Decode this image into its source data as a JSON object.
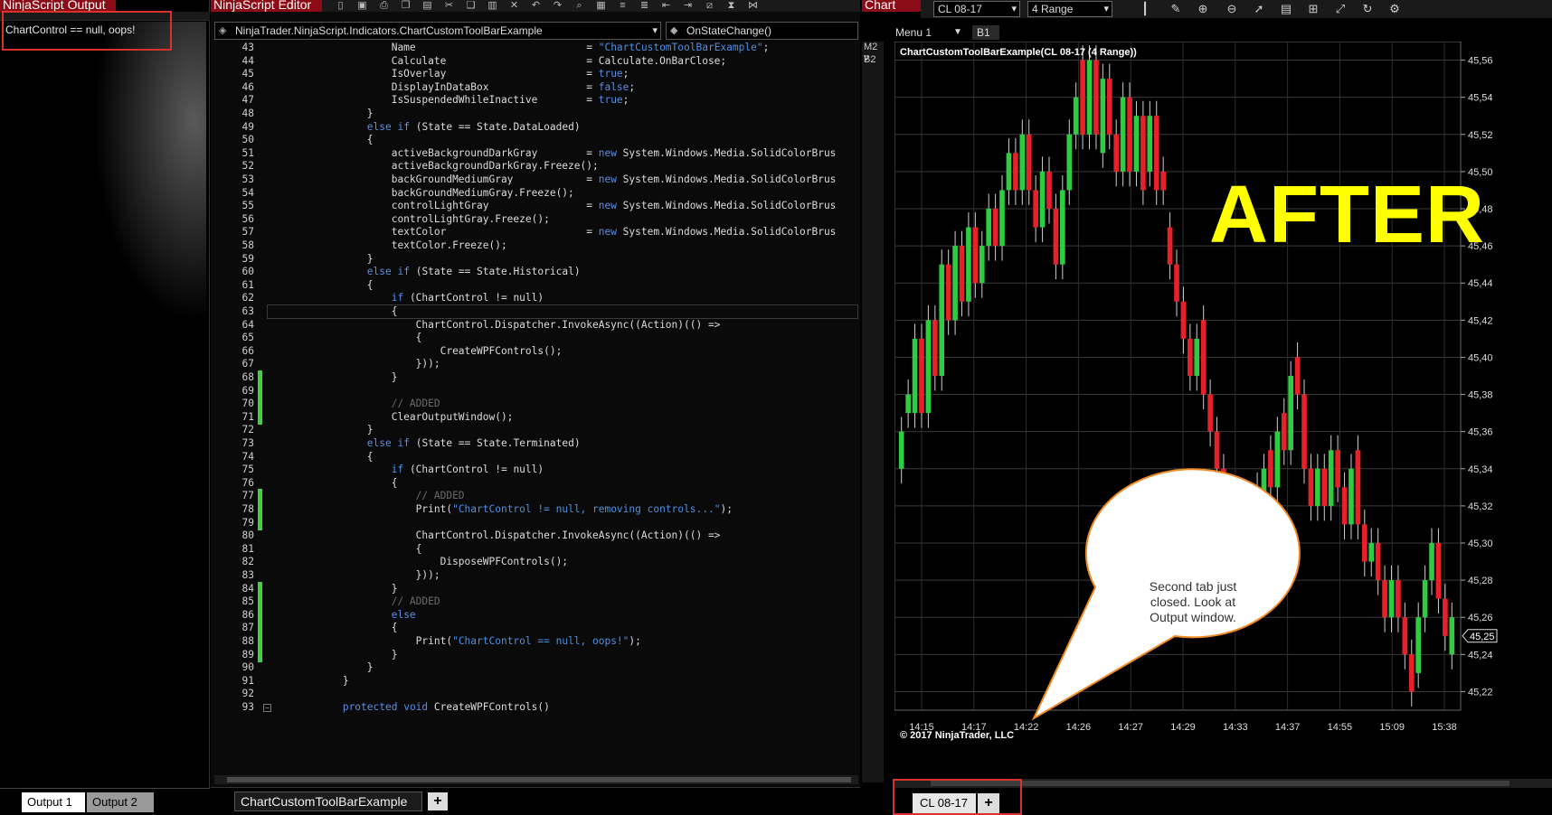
{
  "output": {
    "title": "NinjaScript Output",
    "line": "ChartControl == null, oops!",
    "tabs": [
      "Output 1",
      "Output 2"
    ]
  },
  "editor": {
    "title": "NinjaScript Editor",
    "class_combo": "NinjaTrader.NinjaScript.Indicators.ChartCustomToolBarExample",
    "method_combo": "OnStateChange()",
    "tab": "ChartCustomToolBarExample",
    "add_tab": "+",
    "lines": [
      {
        "n": "43",
        "code": "                    Name                            = \"ChartCustomToolBarExample\";",
        "chg": false
      },
      {
        "n": "44",
        "code": "                    Calculate                       = Calculate.OnBarClose;",
        "chg": false
      },
      {
        "n": "45",
        "code": "                    IsOverlay                       = true;",
        "chg": false
      },
      {
        "n": "46",
        "code": "                    DisplayInDataBox                = false;",
        "chg": false
      },
      {
        "n": "47",
        "code": "                    IsSuspendedWhileInactive        = true;",
        "chg": false
      },
      {
        "n": "48",
        "code": "                }",
        "chg": false
      },
      {
        "n": "49",
        "code": "                else if (State == State.DataLoaded)",
        "chg": false
      },
      {
        "n": "50",
        "code": "                {",
        "chg": false
      },
      {
        "n": "51",
        "code": "                    activeBackgroundDarkGray        = new System.Windows.Media.SolidColorBrus",
        "chg": false
      },
      {
        "n": "52",
        "code": "                    activeBackgroundDarkGray.Freeze();",
        "chg": false
      },
      {
        "n": "53",
        "code": "                    backGroundMediumGray            = new System.Windows.Media.SolidColorBrus",
        "chg": false
      },
      {
        "n": "54",
        "code": "                    backGroundMediumGray.Freeze();",
        "chg": false
      },
      {
        "n": "55",
        "code": "                    controlLightGray                = new System.Windows.Media.SolidColorBrus",
        "chg": false
      },
      {
        "n": "56",
        "code": "                    controlLightGray.Freeze();",
        "chg": false
      },
      {
        "n": "57",
        "code": "                    textColor                       = new System.Windows.Media.SolidColorBrus",
        "chg": false
      },
      {
        "n": "58",
        "code": "                    textColor.Freeze();",
        "chg": false
      },
      {
        "n": "59",
        "code": "                }",
        "chg": false
      },
      {
        "n": "60",
        "code": "                else if (State == State.Historical)",
        "chg": false
      },
      {
        "n": "61",
        "code": "                {",
        "chg": false
      },
      {
        "n": "62",
        "code": "                    if (ChartControl != null)",
        "chg": false
      },
      {
        "n": "63",
        "code": "                    {",
        "chg": false
      },
      {
        "n": "64",
        "code": "                        ChartControl.Dispatcher.InvokeAsync((Action)(() =>",
        "chg": false
      },
      {
        "n": "65",
        "code": "                        {",
        "chg": false
      },
      {
        "n": "66",
        "code": "                            CreateWPFControls();",
        "chg": false
      },
      {
        "n": "67",
        "code": "                        }));",
        "chg": false
      },
      {
        "n": "68",
        "code": "                    }",
        "chg": true
      },
      {
        "n": "69",
        "code": "",
        "chg": true
      },
      {
        "n": "70",
        "code": "                    // ADDED",
        "chg": true
      },
      {
        "n": "71",
        "code": "                    ClearOutputWindow();",
        "chg": true
      },
      {
        "n": "72",
        "code": "                }",
        "chg": false
      },
      {
        "n": "73",
        "code": "                else if (State == State.Terminated)",
        "chg": false
      },
      {
        "n": "74",
        "code": "                {",
        "chg": false
      },
      {
        "n": "75",
        "code": "                    if (ChartControl != null)",
        "chg": false
      },
      {
        "n": "76",
        "code": "                    {",
        "chg": false
      },
      {
        "n": "77",
        "code": "                        // ADDED",
        "chg": true
      },
      {
        "n": "78",
        "code": "                        Print(\"ChartControl != null, removing controls...\");",
        "chg": true
      },
      {
        "n": "79",
        "code": "",
        "chg": true
      },
      {
        "n": "80",
        "code": "                        ChartControl.Dispatcher.InvokeAsync((Action)(() =>",
        "chg": false
      },
      {
        "n": "81",
        "code": "                        {",
        "chg": false
      },
      {
        "n": "82",
        "code": "                            DisposeWPFControls();",
        "chg": false
      },
      {
        "n": "83",
        "code": "                        }));",
        "chg": false
      },
      {
        "n": "84",
        "code": "                    }",
        "chg": true
      },
      {
        "n": "85",
        "code": "                    // ADDED",
        "chg": true
      },
      {
        "n": "86",
        "code": "                    else",
        "chg": true
      },
      {
        "n": "87",
        "code": "                    {",
        "chg": true
      },
      {
        "n": "88",
        "code": "                        Print(\"ChartControl == null, oops!\");",
        "chg": true
      },
      {
        "n": "89",
        "code": "                    }",
        "chg": true
      },
      {
        "n": "90",
        "code": "                }",
        "chg": false
      },
      {
        "n": "91",
        "code": "            }",
        "chg": false
      },
      {
        "n": "92",
        "code": "",
        "chg": false
      },
      {
        "n": "93",
        "code": "            protected void CreateWPFControls()",
        "chg": false
      }
    ]
  },
  "chart": {
    "title": "Chart",
    "instrument": "CL 08-17",
    "period": "4 Range",
    "menu": "Menu 1",
    "bars_tab": "B1",
    "side_labels": [
      "M2 v",
      "B2"
    ],
    "label": "ChartCustomToolBarExample(CL 08-17 (4 Range))",
    "watermark": "© 2017 NinjaTrader, LLC",
    "overlay": "AFTER",
    "callout": "Second tab just closed. Look at Output window.",
    "tab": "CL 08-17",
    "add_tab": "+",
    "colors": {
      "up": "#2ecc40",
      "down": "#e8202a",
      "overlay": "#ffff00",
      "highlight": "#d9322b",
      "callout_border": "#f08a24"
    }
  },
  "chart_data": {
    "type": "candlestick",
    "y_ticks": [
      "45,56",
      "45,54",
      "45,52",
      "45,50",
      "45,48",
      "45,46",
      "45,44",
      "45,42",
      "45,40",
      "45,38",
      "45,36",
      "45,34",
      "45,32",
      "45,30",
      "45,28",
      "45,26",
      "45,24",
      "45,22"
    ],
    "ylim": [
      45.21,
      45.57
    ],
    "x_ticks": [
      "14:15",
      "14:17",
      "14:22",
      "14:26",
      "14:27",
      "14:29",
      "14:33",
      "14:37",
      "14:55",
      "15:09",
      "15:38"
    ],
    "last_price": "45,25",
    "bars": [
      {
        "o": 45.34,
        "c": 45.36,
        "d": "up"
      },
      {
        "o": 45.37,
        "c": 45.38,
        "d": "up"
      },
      {
        "o": 45.37,
        "c": 45.41,
        "d": "up"
      },
      {
        "o": 45.41,
        "c": 45.37,
        "d": "down"
      },
      {
        "o": 45.37,
        "c": 45.42,
        "d": "up"
      },
      {
        "o": 45.42,
        "c": 45.39,
        "d": "down"
      },
      {
        "o": 45.39,
        "c": 45.45,
        "d": "up"
      },
      {
        "o": 45.45,
        "c": 45.42,
        "d": "down"
      },
      {
        "o": 45.42,
        "c": 45.46,
        "d": "up"
      },
      {
        "o": 45.46,
        "c": 45.43,
        "d": "down"
      },
      {
        "o": 45.43,
        "c": 45.47,
        "d": "up"
      },
      {
        "o": 45.47,
        "c": 45.44,
        "d": "down"
      },
      {
        "o": 45.44,
        "c": 45.46,
        "d": "up"
      },
      {
        "o": 45.46,
        "c": 45.48,
        "d": "up"
      },
      {
        "o": 45.48,
        "c": 45.46,
        "d": "down"
      },
      {
        "o": 45.46,
        "c": 45.49,
        "d": "up"
      },
      {
        "o": 45.49,
        "c": 45.51,
        "d": "up"
      },
      {
        "o": 45.51,
        "c": 45.49,
        "d": "down"
      },
      {
        "o": 45.49,
        "c": 45.52,
        "d": "up"
      },
      {
        "o": 45.52,
        "c": 45.49,
        "d": "down"
      },
      {
        "o": 45.49,
        "c": 45.47,
        "d": "down"
      },
      {
        "o": 45.47,
        "c": 45.5,
        "d": "up"
      },
      {
        "o": 45.5,
        "c": 45.48,
        "d": "down"
      },
      {
        "o": 45.48,
        "c": 45.45,
        "d": "down"
      },
      {
        "o": 45.45,
        "c": 45.49,
        "d": "up"
      },
      {
        "o": 45.49,
        "c": 45.52,
        "d": "up"
      },
      {
        "o": 45.52,
        "c": 45.54,
        "d": "up"
      },
      {
        "o": 45.56,
        "c": 45.52,
        "d": "down"
      },
      {
        "o": 45.52,
        "c": 45.56,
        "d": "up"
      },
      {
        "o": 45.56,
        "c": 45.52,
        "d": "down"
      },
      {
        "o": 45.51,
        "c": 45.55,
        "d": "up"
      },
      {
        "o": 45.55,
        "c": 45.52,
        "d": "down"
      },
      {
        "o": 45.52,
        "c": 45.5,
        "d": "down"
      },
      {
        "o": 45.5,
        "c": 45.54,
        "d": "up"
      },
      {
        "o": 45.54,
        "c": 45.5,
        "d": "down"
      },
      {
        "o": 45.5,
        "c": 45.53,
        "d": "up"
      },
      {
        "o": 45.53,
        "c": 45.49,
        "d": "down"
      },
      {
        "o": 45.5,
        "c": 45.53,
        "d": "up"
      },
      {
        "o": 45.53,
        "c": 45.49,
        "d": "down"
      },
      {
        "o": 45.5,
        "c": 45.49,
        "d": "down"
      },
      {
        "o": 45.47,
        "c": 45.45,
        "d": "down"
      },
      {
        "o": 45.45,
        "c": 45.43,
        "d": "down"
      },
      {
        "o": 45.43,
        "c": 45.41,
        "d": "down"
      },
      {
        "o": 45.41,
        "c": 45.39,
        "d": "down"
      },
      {
        "o": 45.39,
        "c": 45.41,
        "d": "up"
      },
      {
        "o": 45.42,
        "c": 45.38,
        "d": "down"
      },
      {
        "o": 45.38,
        "c": 45.36,
        "d": "down"
      },
      {
        "o": 45.36,
        "c": 45.34,
        "d": "down"
      },
      {
        "o": 45.34,
        "c": 45.32,
        "d": "down"
      },
      {
        "o": 45.32,
        "c": 45.3,
        "d": "down"
      },
      {
        "o": 45.3,
        "c": 45.32,
        "d": "up"
      },
      {
        "o": 45.32,
        "c": 45.3,
        "d": "down"
      },
      {
        "o": 45.3,
        "c": 45.32,
        "d": "up"
      },
      {
        "o": 45.33,
        "c": 45.31,
        "d": "down"
      },
      {
        "o": 45.31,
        "c": 45.34,
        "d": "up"
      },
      {
        "o": 45.35,
        "c": 45.33,
        "d": "down"
      },
      {
        "o": 45.33,
        "c": 45.36,
        "d": "up"
      },
      {
        "o": 45.37,
        "c": 45.35,
        "d": "down"
      },
      {
        "o": 45.35,
        "c": 45.39,
        "d": "up"
      },
      {
        "o": 45.4,
        "c": 45.38,
        "d": "down"
      },
      {
        "o": 45.38,
        "c": 45.34,
        "d": "down"
      },
      {
        "o": 45.34,
        "c": 45.32,
        "d": "down"
      },
      {
        "o": 45.32,
        "c": 45.34,
        "d": "up"
      },
      {
        "o": 45.34,
        "c": 45.32,
        "d": "down"
      },
      {
        "o": 45.32,
        "c": 45.35,
        "d": "up"
      },
      {
        "o": 45.35,
        "c": 45.33,
        "d": "down"
      },
      {
        "o": 45.33,
        "c": 45.31,
        "d": "down"
      },
      {
        "o": 45.31,
        "c": 45.34,
        "d": "up"
      },
      {
        "o": 45.35,
        "c": 45.31,
        "d": "down"
      },
      {
        "o": 45.31,
        "c": 45.29,
        "d": "down"
      },
      {
        "o": 45.29,
        "c": 45.3,
        "d": "up"
      },
      {
        "o": 45.3,
        "c": 45.28,
        "d": "down"
      },
      {
        "o": 45.28,
        "c": 45.26,
        "d": "down"
      },
      {
        "o": 45.26,
        "c": 45.28,
        "d": "up"
      },
      {
        "o": 45.28,
        "c": 45.26,
        "d": "down"
      },
      {
        "o": 45.26,
        "c": 45.24,
        "d": "down"
      },
      {
        "o": 45.24,
        "c": 45.22,
        "d": "down"
      },
      {
        "o": 45.23,
        "c": 45.26,
        "d": "up"
      },
      {
        "o": 45.26,
        "c": 45.28,
        "d": "up"
      },
      {
        "o": 45.28,
        "c": 45.3,
        "d": "up"
      },
      {
        "o": 45.3,
        "c": 45.27,
        "d": "down"
      },
      {
        "o": 45.27,
        "c": 45.25,
        "d": "down"
      },
      {
        "o": 45.24,
        "c": 45.26,
        "d": "up"
      }
    ]
  }
}
